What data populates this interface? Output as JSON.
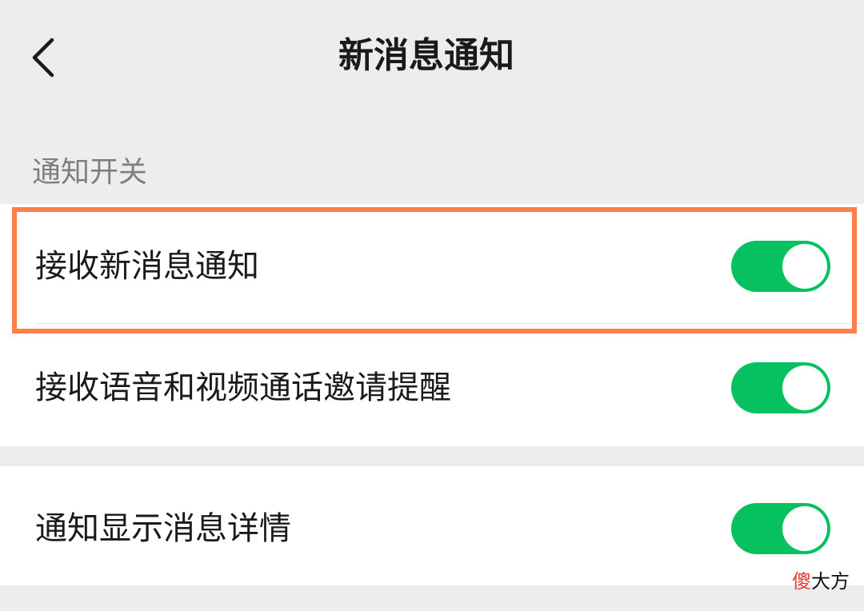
{
  "nav": {
    "back_icon": "chevron-left-icon",
    "title": "新消息通知"
  },
  "section": {
    "label": "通知开关"
  },
  "settings": [
    {
      "label": "接收新消息通知",
      "enabled": true
    },
    {
      "label": "接收语音和视频通话邀请提醒",
      "enabled": true
    },
    {
      "label": "通知显示消息详情",
      "enabled": true
    }
  ],
  "highlight": {
    "color": "#fe7f4c"
  },
  "colors": {
    "toggle_on": "#07c160",
    "background": "#ededed",
    "card": "#ffffff"
  },
  "watermark": {
    "accent": "傻",
    "rest": "大方"
  }
}
